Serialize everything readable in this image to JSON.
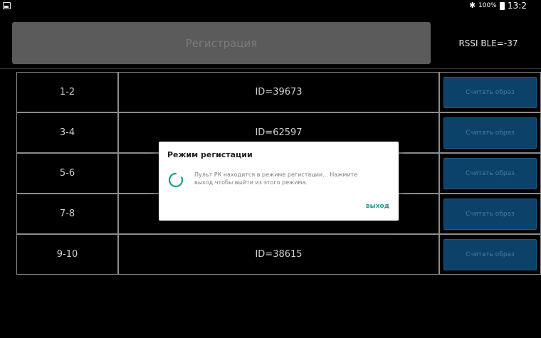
{
  "status_bar": {
    "icons": [
      "gallery-icon",
      "bluetooth-icon",
      "battery-icon"
    ],
    "battery_percent": "100%",
    "time": "13:2"
  },
  "header": {
    "register_label": "Регистрация",
    "rssi_label": "RSSI BLE=-37"
  },
  "rows": [
    {
      "num": "1-2",
      "id": "ID=39673",
      "button": "Считать образ"
    },
    {
      "num": "3-4",
      "id": "ID=62597",
      "button": "Считать образ"
    },
    {
      "num": "5-6",
      "id": "",
      "button": "Считать образ"
    },
    {
      "num": "7-8",
      "id": "",
      "button": "Считать образ"
    },
    {
      "num": "9-10",
      "id": "ID=38615",
      "button": "Считать образ"
    }
  ],
  "dialog": {
    "title": "Режим регистации",
    "message_line1": "Пульт РК находится в режиме регистации... Нажмите",
    "message_line2": "выход чтобы выйти из этого режима.",
    "exit_label": "выход",
    "accent_color": "#1f9c8e"
  },
  "colors": {
    "background": "#000000",
    "button_blue": "#0c4169",
    "header_button": "#5b5b5b"
  }
}
